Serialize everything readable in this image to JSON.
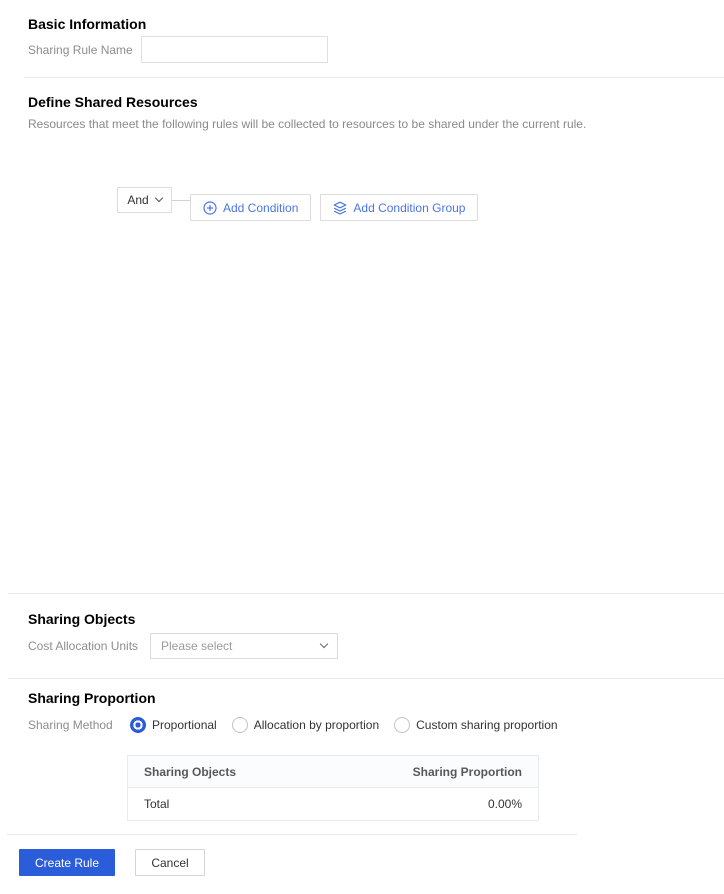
{
  "colors": {
    "primary": "#2b5cd9",
    "link": "#4a76e3"
  },
  "icons": {
    "operator_dropdown": "chevron-down-icon",
    "add_condition": "circle-plus-icon",
    "add_condition_group": "layers-icon",
    "units_select": "chevron-down-icon"
  },
  "basic_info": {
    "title": "Basic Information",
    "rule_name_label": "Sharing Rule Name",
    "rule_name_value": ""
  },
  "shared_resources": {
    "title": "Define Shared Resources",
    "description": "Resources that meet the following rules will be collected to resources to be shared under the current rule.",
    "operator_value": "And",
    "add_condition_label": "Add Condition",
    "add_condition_group_label": "Add Condition Group"
  },
  "sharing_objects": {
    "title": "Sharing Objects",
    "units_label": "Cost Allocation Units",
    "units_placeholder": "Please select"
  },
  "sharing_proportion": {
    "title": "Sharing Proportion",
    "method_label": "Sharing Method",
    "methods": [
      {
        "label": "Proportional",
        "selected": true
      },
      {
        "label": "Allocation by proportion",
        "selected": false
      },
      {
        "label": "Custom sharing proportion",
        "selected": false
      }
    ],
    "table": {
      "columns": [
        "Sharing Objects",
        "Sharing Proportion"
      ],
      "rows": [
        {
          "object": "Total",
          "proportion": "0.00%"
        }
      ]
    }
  },
  "footer": {
    "create_label": "Create Rule",
    "cancel_label": "Cancel"
  }
}
